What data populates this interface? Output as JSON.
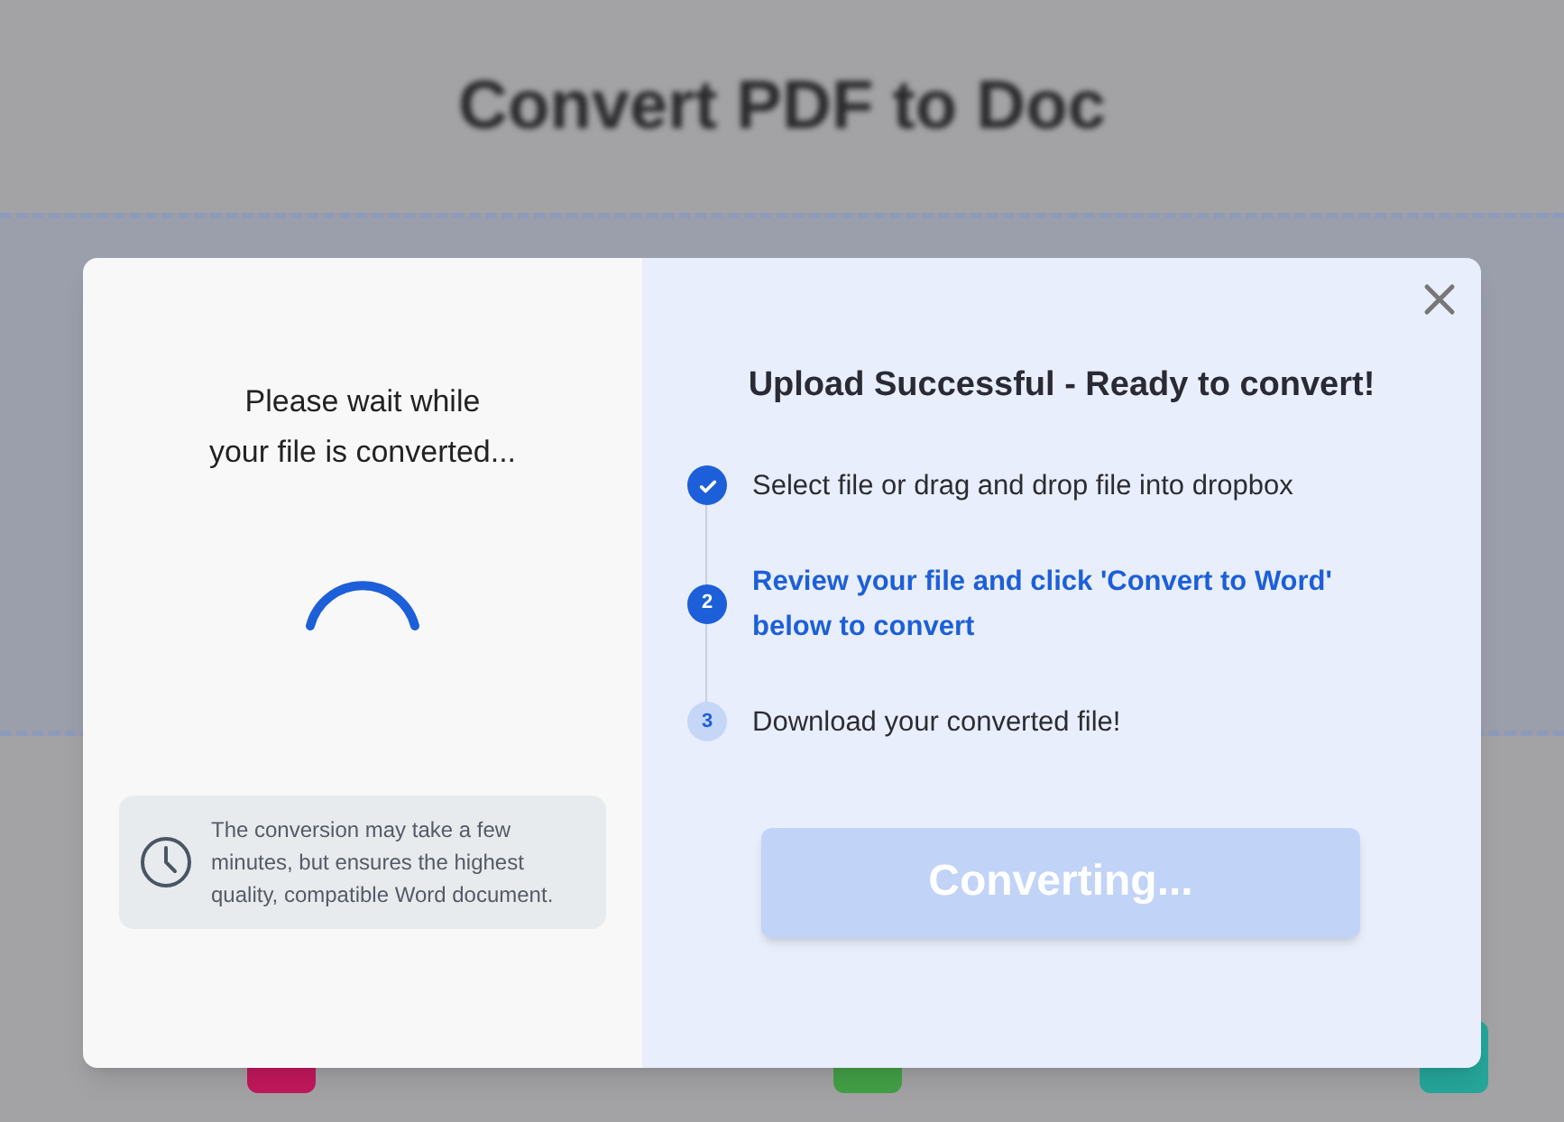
{
  "page": {
    "title": "Convert PDF to Doc",
    "cards": [
      {
        "color": "#c2185b"
      },
      {
        "color": "#43a047"
      },
      {
        "color": "#26a69a"
      }
    ]
  },
  "modal": {
    "wait_message": "Please wait while\nyour file is converted...",
    "note": "The conversion may take a few minutes, but ensures the highest quality, compatible Word document.",
    "heading": "Upload Successful - Ready to convert!",
    "steps": [
      {
        "text": "Select file or drag and drop file into dropbox",
        "kind": "done"
      },
      {
        "marker": "2",
        "text": "Review your file and click 'Convert to Word' below to convert",
        "kind": "current"
      },
      {
        "marker": "3",
        "text": "Download your converted file!",
        "kind": "pending"
      }
    ],
    "button": {
      "label": "Converting...",
      "disabled": true
    }
  }
}
